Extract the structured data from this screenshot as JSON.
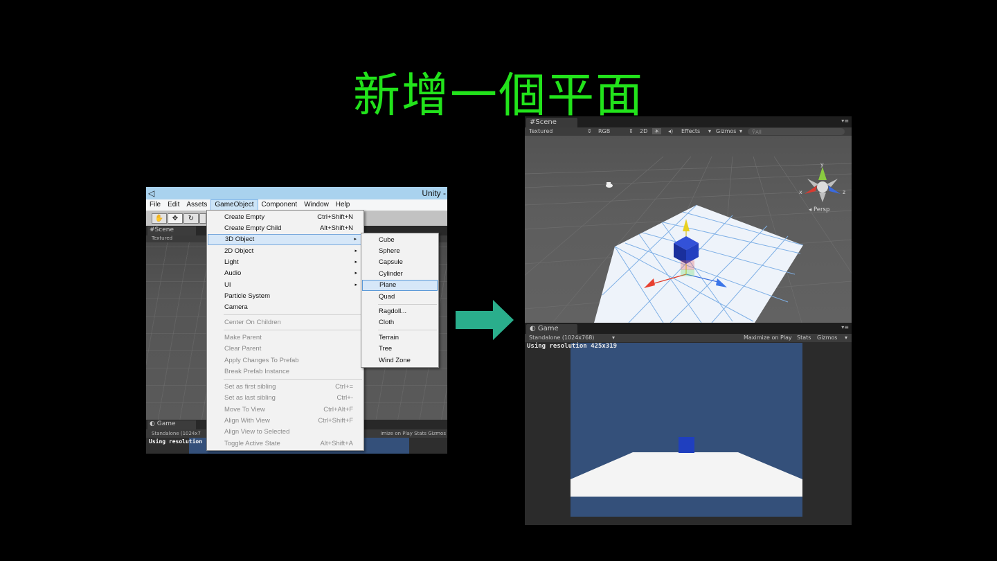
{
  "slide": {
    "title": "新增一個平面"
  },
  "left": {
    "window_title": "Unity -",
    "menubar": [
      "File",
      "Edit",
      "Assets",
      "GameObject",
      "Component",
      "Window",
      "Help"
    ],
    "scene_tab": "Scene",
    "scene_mode": "Textured",
    "game_tab": "Game",
    "game_aspect": "Standalone (1024x7",
    "game_right": "imize on Play  Stats  Gizmos",
    "resolution_text": "Using resolution",
    "gameobject_menu": {
      "create_empty": {
        "label": "Create Empty",
        "shortcut": "Ctrl+Shift+N"
      },
      "create_empty_child": {
        "label": "Create Empty Child",
        "shortcut": "Alt+Shift+N"
      },
      "object_3d": "3D Object",
      "object_2d": "2D Object",
      "light": "Light",
      "audio": "Audio",
      "ui": "UI",
      "particle_system": "Particle System",
      "camera": "Camera",
      "center_on_children": "Center On Children",
      "make_parent": "Make Parent",
      "clear_parent": "Clear Parent",
      "apply_changes": "Apply Changes To Prefab",
      "break_prefab": "Break Prefab Instance",
      "first_sibling": {
        "label": "Set as first sibling",
        "shortcut": "Ctrl+="
      },
      "last_sibling": {
        "label": "Set as last sibling",
        "shortcut": "Ctrl+-"
      },
      "move_to_view": {
        "label": "Move To View",
        "shortcut": "Ctrl+Alt+F"
      },
      "align_with_view": {
        "label": "Align With View",
        "shortcut": "Ctrl+Shift+F"
      },
      "align_view_selected": "Align View to Selected",
      "toggle_active": {
        "label": "Toggle Active State",
        "shortcut": "Alt+Shift+A"
      }
    },
    "submenu_3d": {
      "cube": "Cube",
      "sphere": "Sphere",
      "capsule": "Capsule",
      "cylinder": "Cylinder",
      "plane": "Plane",
      "quad": "Quad",
      "ragdoll": "Ragdoll...",
      "cloth": "Cloth",
      "terrain": "Terrain",
      "tree": "Tree",
      "wind_zone": "Wind Zone"
    }
  },
  "right": {
    "scene_tab": "Scene",
    "scene_toolbar": {
      "mode": "Textured",
      "color": "RGB",
      "twod": "2D",
      "effects": "Effects",
      "gizmos": "Gizmos",
      "search_placeholder": "All"
    },
    "gizmo": {
      "y": "y",
      "x": "x",
      "z": "z",
      "persp": "Persp"
    },
    "game_tab": "Game",
    "game_aspect": "Standalone (1024x768)",
    "game_toolbar": {
      "maximize": "Maximize on Play",
      "stats": "Stats",
      "gizmos": "Gizmos"
    },
    "resolution_text": "Using resolution 425x319"
  },
  "colors": {
    "title_green": "#22e31b",
    "arrow_teal": "#2aae8c",
    "game_sky": "#34507a",
    "cube_blue": "#1f3fbf",
    "menu_highlight": "#d6e7f8"
  }
}
